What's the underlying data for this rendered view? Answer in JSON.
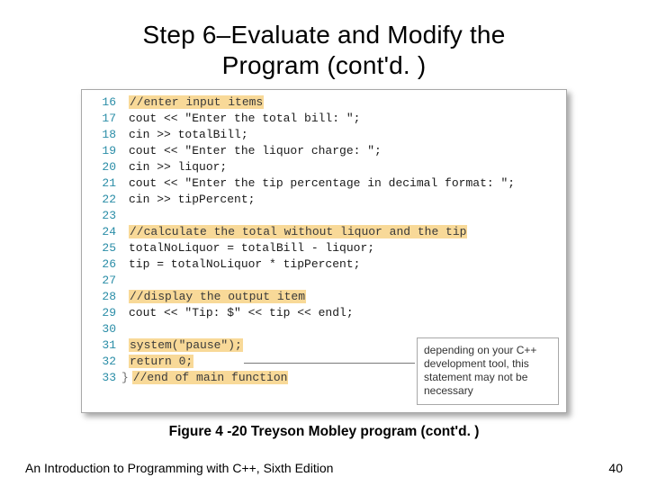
{
  "title_line1": "Step 6–Evaluate and Modify the",
  "title_line2": "Program (cont'd. )",
  "lines": [
    {
      "n": "16",
      "type": "comment",
      "text": "//enter input items"
    },
    {
      "n": "17",
      "type": "code",
      "text": "cout << \"Enter the total bill: \";"
    },
    {
      "n": "18",
      "type": "code",
      "text": "cin >> totalBill;"
    },
    {
      "n": "19",
      "type": "code",
      "text": "cout << \"Enter the liquor charge: \";"
    },
    {
      "n": "20",
      "type": "code",
      "text": "cin >> liquor;"
    },
    {
      "n": "21",
      "type": "code",
      "text": "cout << \"Enter the tip percentage in decimal format: \";"
    },
    {
      "n": "22",
      "type": "code",
      "text": "cin >> tipPercent;"
    },
    {
      "n": "23",
      "type": "blank",
      "text": ""
    },
    {
      "n": "24",
      "type": "comment",
      "text": "//calculate the total without liquor and the tip"
    },
    {
      "n": "25",
      "type": "code",
      "text": "totalNoLiquor = totalBill - liquor;"
    },
    {
      "n": "26",
      "type": "code",
      "text": "tip = totalNoLiquor * tipPercent;"
    },
    {
      "n": "27",
      "type": "blank",
      "text": ""
    },
    {
      "n": "28",
      "type": "comment",
      "text": "//display the output item"
    },
    {
      "n": "29",
      "type": "code",
      "text": "cout << \"Tip: $\" << tip << endl;"
    },
    {
      "n": "30",
      "type": "blank",
      "text": ""
    },
    {
      "n": "31",
      "type": "highlight",
      "text": "system(\"pause\");"
    },
    {
      "n": "32",
      "type": "highlight",
      "text": "return 0;"
    },
    {
      "n": "33",
      "type": "endcomment",
      "text": "//end of main function",
      "brace": "}"
    }
  ],
  "callout": "depending on your C++ development tool, this statement may not be necessary",
  "caption": "Figure 4 -20 Treyson Mobley program (cont'd. )",
  "footer_left": "An Introduction to Programming with C++, Sixth Edition",
  "footer_right": "40"
}
